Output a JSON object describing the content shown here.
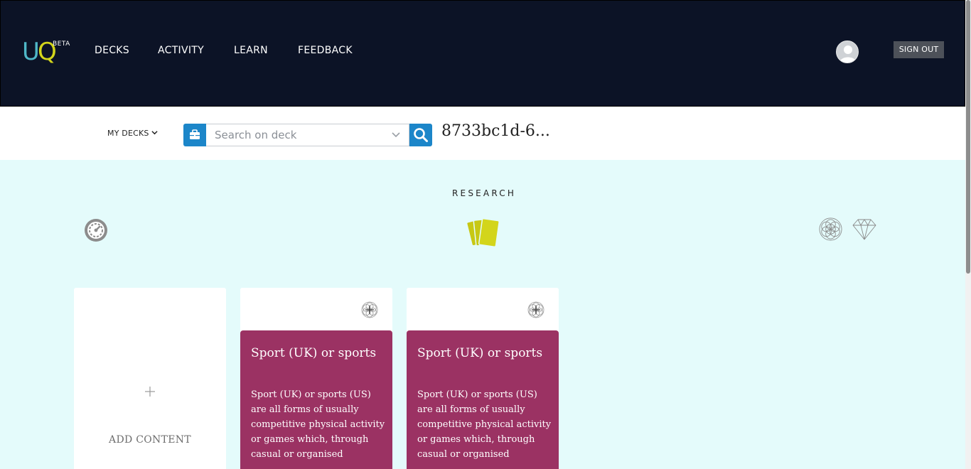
{
  "brand": {
    "logo_u": "U",
    "logo_q": "Q",
    "beta": "BETA"
  },
  "nav": [
    {
      "label": "DECKS"
    },
    {
      "label": "ACTIVITY"
    },
    {
      "label": "LEARN"
    },
    {
      "label": "FEEDBACK"
    }
  ],
  "user": {
    "signout_label": "SIGN OUT"
  },
  "subbar": {
    "mydecks_label": "MY DECKS",
    "search_placeholder": "Search on deck",
    "search_value": "",
    "deck_title": "8733bc1d-6..."
  },
  "main": {
    "section_label": "RESEARCH",
    "add_card_label": "ADD CONTENT",
    "cards": [
      {
        "title": "Sport (UK) or sports",
        "text": "Sport (UK) or sports (US) are all forms of usually competitive physical activity or games which, through casual or organised"
      },
      {
        "title": "Sport (UK) or sports",
        "text": "Sport (UK) or sports (US) are all forms of usually competitive physical activity or games which, through casual or organised"
      }
    ]
  },
  "colors": {
    "topbar": "#0c1326",
    "accent_blue": "#1c86c9",
    "card_body": "#9b3263",
    "background": "#e4fbfb",
    "logo_u": "#4fb7c7",
    "logo_q": "#d3d51b"
  },
  "icons": {
    "search": "search-icon",
    "briefcase": "briefcase-icon",
    "gauge": "gauge-icon",
    "cards": "cards-icon",
    "flower": "flower-of-life-icon",
    "diamond": "diamond-icon",
    "plus": "plus-icon"
  }
}
